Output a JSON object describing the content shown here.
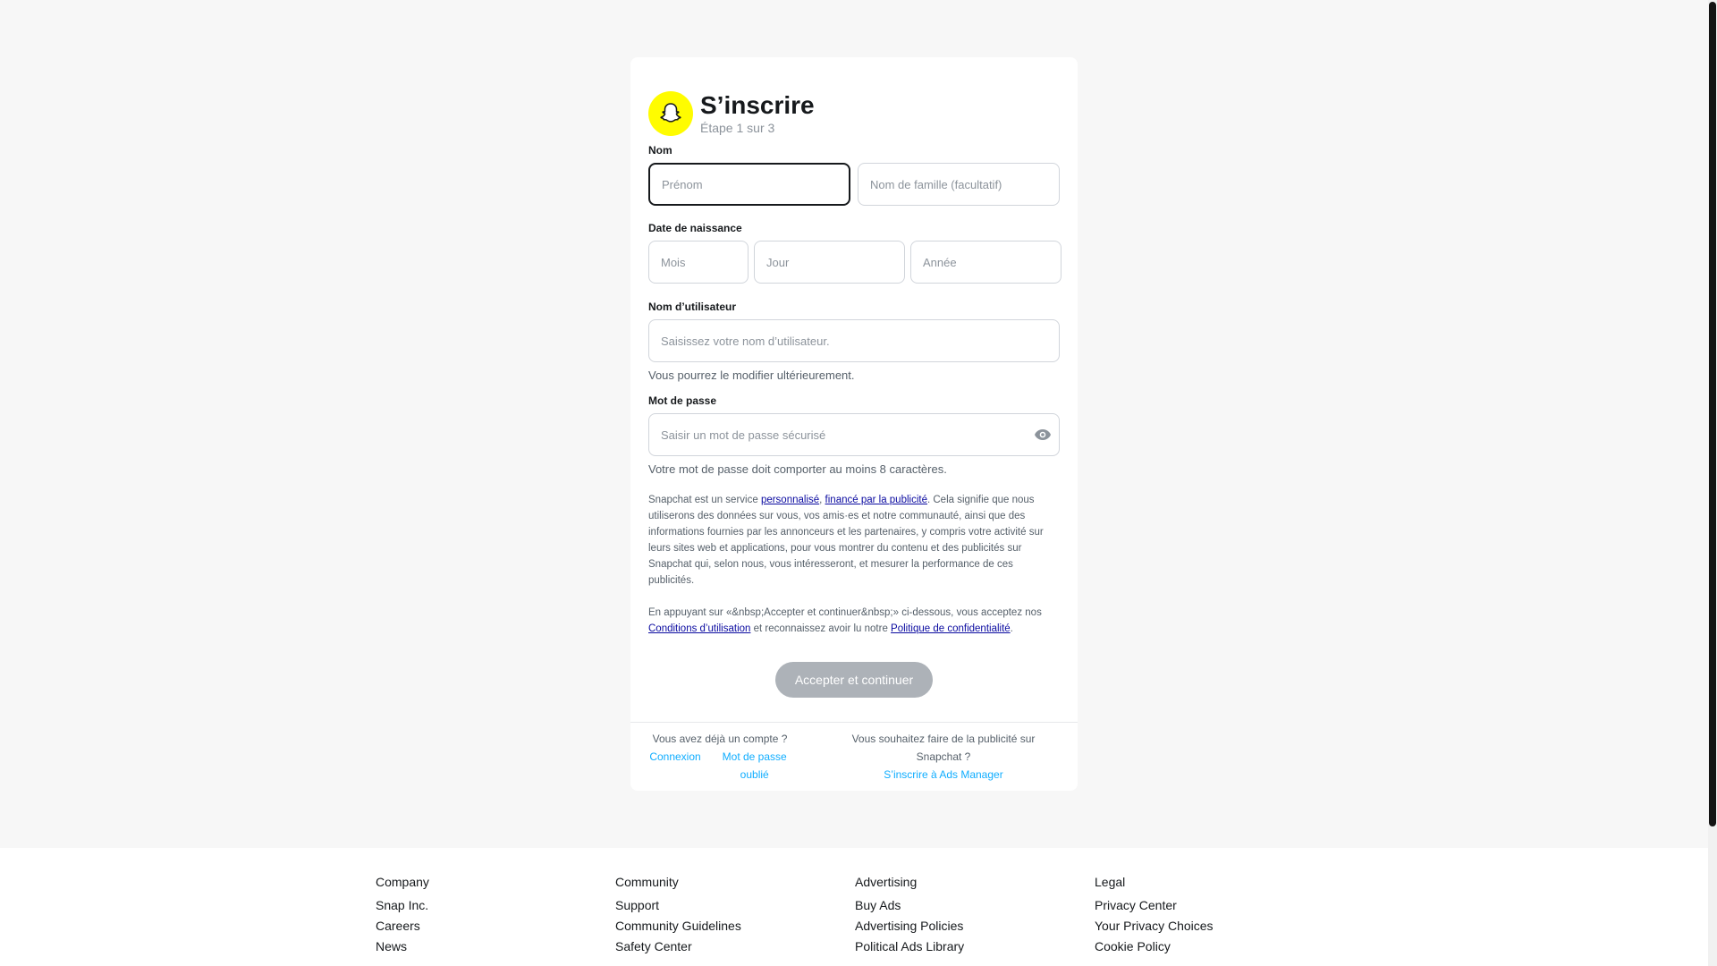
{
  "signup": {
    "title": "S’inscrire",
    "step": "Étape 1 sur 3",
    "name_label": "Nom",
    "first_name_placeholder": "Prénom",
    "last_name_placeholder": "Nom de famille (facultatif)",
    "dob_label": "Date de naissance",
    "month_placeholder": "Mois",
    "day_placeholder": "Jour",
    "year_placeholder": "Année",
    "username_label": "Nom d’utilisateur",
    "username_placeholder": "Saisissez votre nom d’utilisateur.",
    "username_help": "Vous pourrez le modifier ultérieurement.",
    "password_label": "Mot de passe",
    "password_placeholder": "Saisir un mot de passe sécurisé",
    "password_help": "Votre mot de passe doit comporter au moins 8 caractères.",
    "ads_text_1": "Snapchat est un service ",
    "ads_link_1": "personnalisé",
    "ads_text_2": ", ",
    "ads_link_2": "financé par la publicité",
    "ads_text_3": ". Cela signifie que nous utiliserons des données sur vous, vos amis·es et notre communauté, ainsi que des informations fournies par les annonceurs et les partenaires, y compris votre activité sur leurs sites web et applications, pour vous montrer du contenu et des publicités sur Snapchat qui, selon nous, vous intéresseront, et mesurer la performance de ces publicités.",
    "terms_text_1": "En appuyant sur «&nbsp;Accepter et continuer&nbsp;» ci-dessous, vous acceptez nos ",
    "terms_link": "Conditions d’utilisation",
    "terms_text_2": " et reconnaissez avoir lu notre ",
    "privacy_link": "Politique de confidentialité",
    "terms_text_3": ".",
    "cta": "Accepter et continuer"
  },
  "card_footer": {
    "have_account": "Vous avez déjà un compte ?",
    "login": "Connexion",
    "forgot": "Mot de passe oublié",
    "ads_question": "Vous souhaitez faire de la publicité sur Snapchat ?",
    "ads_signup": "S’inscrire à Ads Manager"
  },
  "footer": {
    "columns": [
      {
        "heading": "Company",
        "links": [
          "Snap Inc.",
          "Careers",
          "News"
        ]
      },
      {
        "heading": "Community",
        "links": [
          "Support",
          "Community Guidelines",
          "Safety Center"
        ]
      },
      {
        "heading": "Advertising",
        "links": [
          "Buy Ads",
          "Advertising Policies",
          "Political Ads Library"
        ]
      },
      {
        "heading": "Legal",
        "links": [
          "Privacy Center",
          "Your Privacy Choices",
          "Cookie Policy"
        ]
      }
    ]
  },
  "icons": {
    "logo": "snapchat-ghost-icon",
    "password_toggle": "eye-icon"
  },
  "colors": {
    "brand_yellow": "#fffc00",
    "link_blue": "#0fadff",
    "legal_link": "#0a0aa0",
    "cta_disabled": "#adb2b8"
  }
}
